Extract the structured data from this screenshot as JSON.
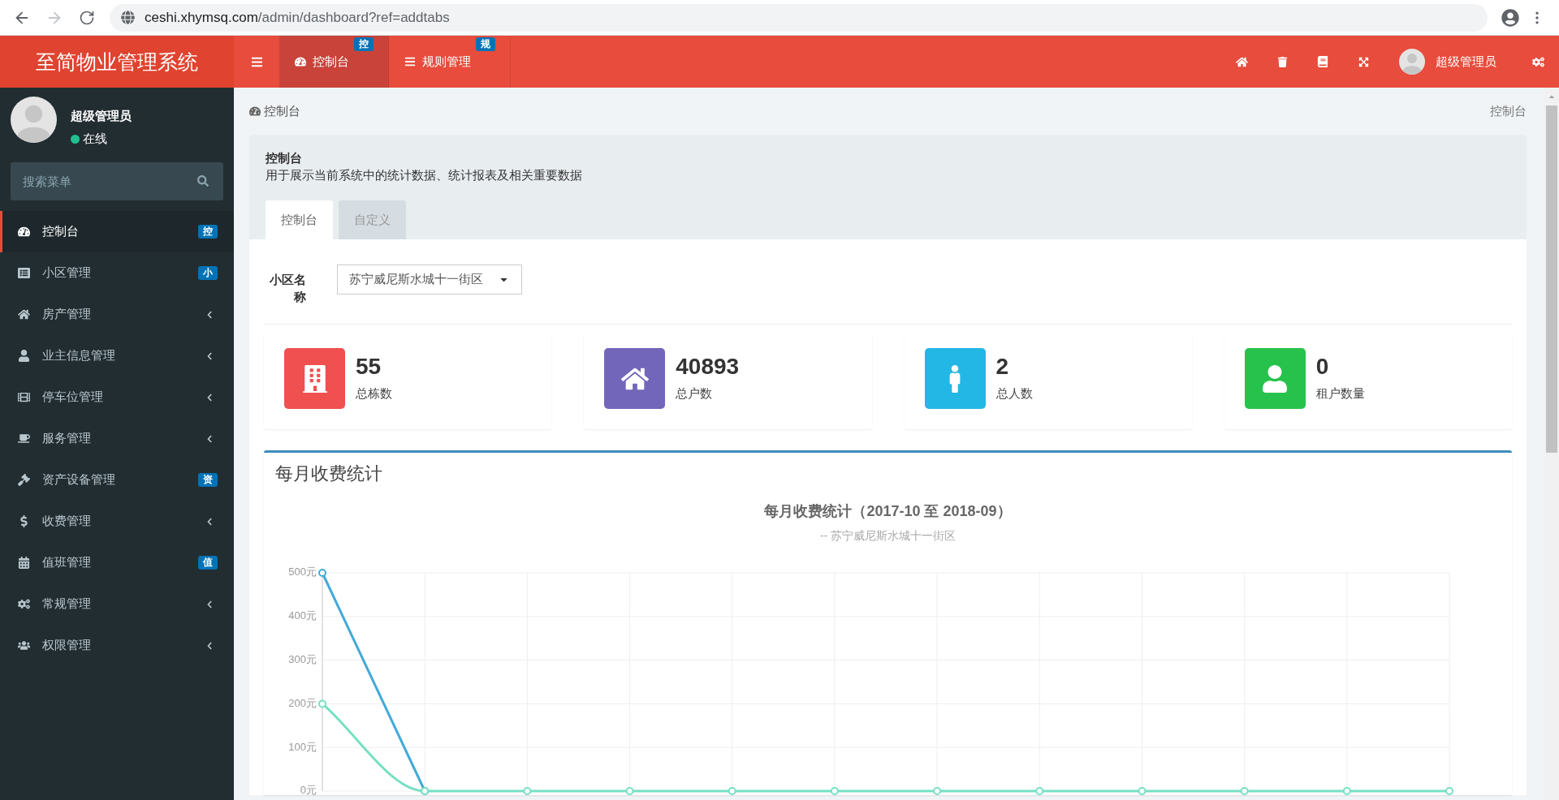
{
  "browser": {
    "back_enabled": true,
    "forward_enabled": false,
    "url_host": "ceshi.xhymsq.com",
    "url_path": "/admin/dashboard?ref=addtabs"
  },
  "header": {
    "logo": "至简物业管理系统",
    "tabs": [
      {
        "label": "控制台",
        "badge": "控",
        "selected": true
      },
      {
        "label": "规则管理",
        "badge": "规",
        "selected": false
      }
    ],
    "user_name": "超级管理员"
  },
  "sidebar": {
    "user": {
      "name": "超级管理员",
      "status": "在线",
      "online": true
    },
    "search": {
      "placeholder": "搜索菜单"
    },
    "items": [
      {
        "label": "控制台",
        "kind": "badge",
        "badge": "控",
        "selected": true
      },
      {
        "label": "小区管理",
        "kind": "badge",
        "badge": "小",
        "selected": false
      },
      {
        "label": "房产管理",
        "kind": "submenu",
        "selected": false
      },
      {
        "label": "业主信息管理",
        "kind": "submenu",
        "selected": false
      },
      {
        "label": "停车位管理",
        "kind": "submenu",
        "selected": false
      },
      {
        "label": "服务管理",
        "kind": "submenu",
        "selected": false
      },
      {
        "label": "资产设备管理",
        "kind": "badge",
        "badge": "资",
        "selected": false
      },
      {
        "label": "收费管理",
        "kind": "submenu",
        "selected": false
      },
      {
        "label": "值班管理",
        "kind": "badge",
        "badge": "值",
        "selected": false
      },
      {
        "label": "常规管理",
        "kind": "submenu",
        "selected": false
      },
      {
        "label": "权限管理",
        "kind": "submenu",
        "selected": false
      }
    ]
  },
  "content_header": {
    "title": "控制台",
    "breadcrumb": "控制台"
  },
  "panel": {
    "title": "控制台",
    "description": "用于展示当前系统中的统计数据、统计报表及相关重要数据",
    "tabs": [
      {
        "label": "控制台",
        "selected": true
      },
      {
        "label": "自定义",
        "selected": false
      }
    ],
    "filter": {
      "label": "小区名称",
      "value": "苏宁威尼斯水城十一街区"
    },
    "stats": [
      {
        "value": "55",
        "label": "总栋数",
        "color": "#f05050"
      },
      {
        "value": "40893",
        "label": "总户数",
        "color": "#7266ba"
      },
      {
        "value": "2",
        "label": "总人数",
        "color": "#23b7e5"
      },
      {
        "value": "0",
        "label": "租户数量",
        "color": "#27c24c"
      }
    ],
    "chart_box": {
      "title": "每月收费统计",
      "subtitle": "-- 苏宁威尼斯水城十一街区",
      "chart_data": {
        "type": "line",
        "title": "每月收费统计（2017-10 至 2018-09）",
        "grid": true,
        "ylim": [
          0,
          500
        ],
        "yticks": [
          {
            "value": 0,
            "label": "0元"
          },
          {
            "value": 100,
            "label": "100元"
          },
          {
            "value": 200,
            "label": "200元"
          },
          {
            "value": 300,
            "label": "300元"
          },
          {
            "value": 400,
            "label": "400元"
          },
          {
            "value": 500,
            "label": "500元"
          }
        ],
        "series": [
          {
            "color": "#44a9d8",
            "marker": "circle",
            "values": [
              500,
              0,
              null,
              null,
              null,
              null,
              null,
              null,
              null,
              null,
              null,
              null
            ]
          },
          {
            "color": "#76e0c3",
            "marker": "circle",
            "values": [
              200,
              0,
              0,
              0,
              0,
              0,
              0,
              0,
              0,
              0,
              0,
              0
            ]
          }
        ]
      }
    }
  }
}
